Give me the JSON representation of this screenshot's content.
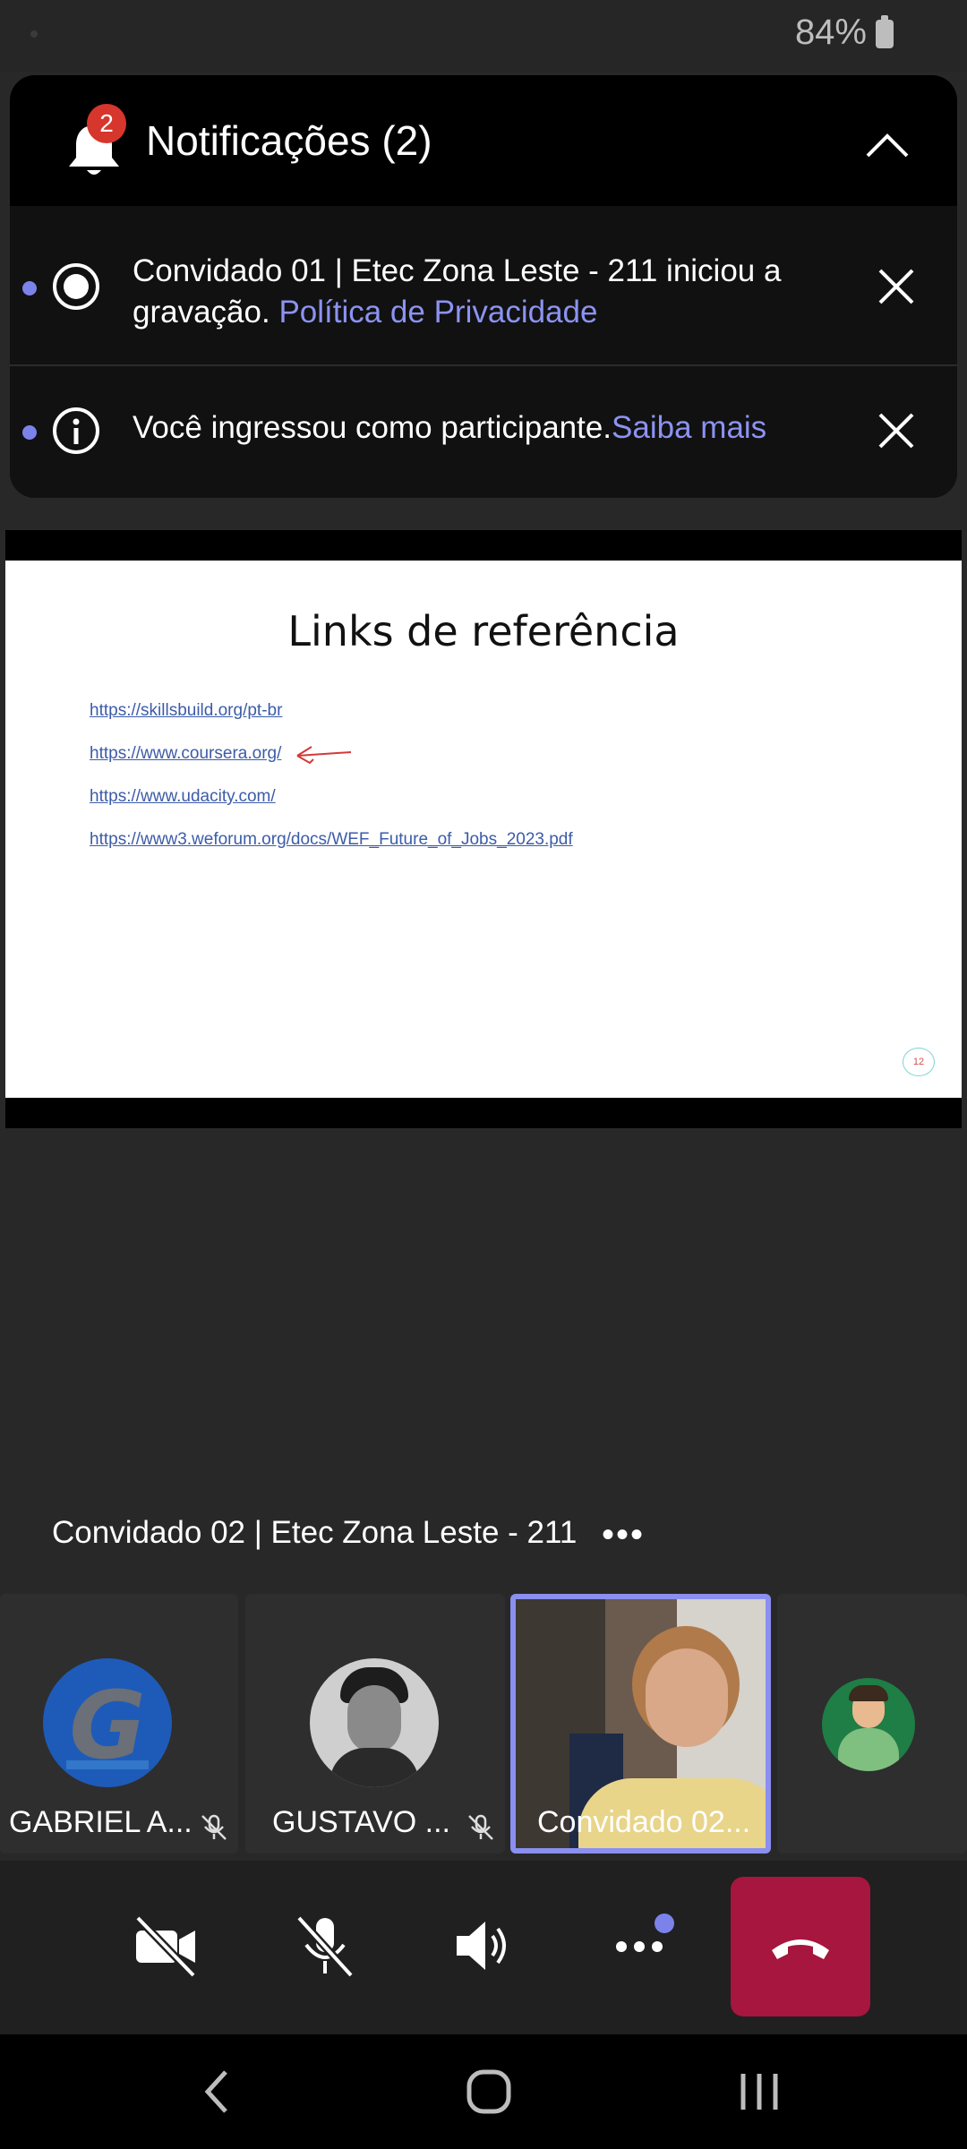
{
  "status_bar": {
    "battery": "84%"
  },
  "notifications": {
    "badge_count": "2",
    "title": "Notificações (2)",
    "items": [
      {
        "text": "Convidado 01 | Etec Zona Leste - 211 iniciou a gravação. ",
        "link": "Política de Privacidade",
        "icon": "record-icon"
      },
      {
        "text": "Você ingressou como participante.",
        "link": "Saiba mais",
        "icon": "info-icon"
      }
    ]
  },
  "slide": {
    "title": "Links de referência",
    "links": [
      "https://skillsbuild.org/pt-br",
      "https://www.coursera.org/",
      "https://www.udacity.com/",
      "https://www3.weforum.org/docs/WEF_Future_of_Jobs_2023.pdf"
    ],
    "page_number": "12"
  },
  "presenter": {
    "name": "Convidado 02 | Etec Zona Leste - 211",
    "more": "•••"
  },
  "participants": [
    {
      "name": "GABRIEL A...",
      "muted": true,
      "avatar_letter": "G"
    },
    {
      "name": "GUSTAVO ...",
      "muted": true
    },
    {
      "name": "Convidado 02...",
      "muted": false,
      "active_speaker": true
    },
    {
      "name": "",
      "muted": false
    }
  ],
  "controls": {
    "camera": "camera-off-icon",
    "mic": "mic-off-icon",
    "speaker": "speaker-icon",
    "more": "more-icon",
    "hangup": "hangup-icon"
  },
  "colors": {
    "accent": "#7b83eb",
    "hangup": "#a6163e",
    "badge": "#d6362c",
    "link": "#8c93f2"
  }
}
